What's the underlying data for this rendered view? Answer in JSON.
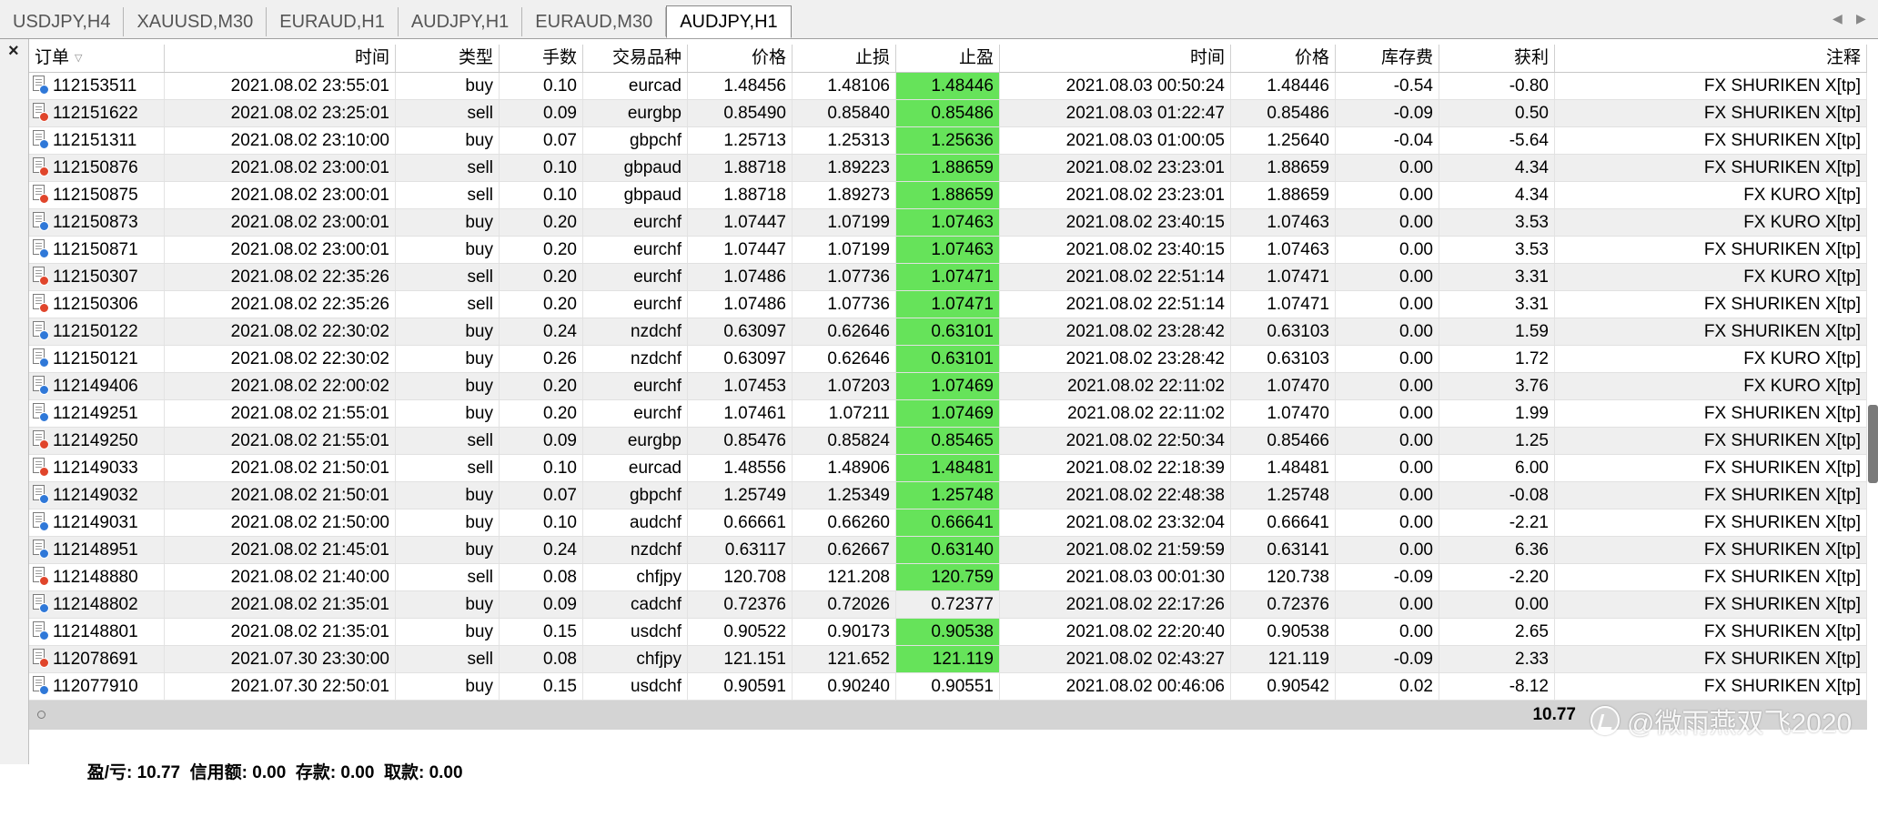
{
  "tabs": [
    "USDJPY,H4",
    "XAUUSD,M30",
    "EURAUD,H1",
    "AUDJPY,H1",
    "EURAUD,M30",
    "AUDJPY,H1"
  ],
  "active_tab_index": 5,
  "columns": [
    "订单",
    "时间",
    "类型",
    "手数",
    "交易品种",
    "价格",
    "止损",
    "止盈",
    "时间",
    "价格",
    "库存费",
    "获利",
    "注释"
  ],
  "tp_highlight_color": "#66e35a",
  "rows": [
    {
      "order": "112153511",
      "open_time": "2021.08.02 23:55:01",
      "type": "buy",
      "lots": "0.10",
      "symbol": "eurcad",
      "price": "1.48456",
      "sl": "1.48106",
      "tp": "1.48446",
      "tp_hit": true,
      "close_time": "2021.08.03 00:50:24",
      "close_price": "1.48446",
      "swap": "-0.54",
      "profit": "-0.80",
      "comment": "FX SHURIKEN X[tp]"
    },
    {
      "order": "112151622",
      "open_time": "2021.08.02 23:25:01",
      "type": "sell",
      "lots": "0.09",
      "symbol": "eurgbp",
      "price": "0.85490",
      "sl": "0.85840",
      "tp": "0.85486",
      "tp_hit": true,
      "close_time": "2021.08.03 01:22:47",
      "close_price": "0.85486",
      "swap": "-0.09",
      "profit": "0.50",
      "comment": "FX SHURIKEN X[tp]"
    },
    {
      "order": "112151311",
      "open_time": "2021.08.02 23:10:00",
      "type": "buy",
      "lots": "0.07",
      "symbol": "gbpchf",
      "price": "1.25713",
      "sl": "1.25313",
      "tp": "1.25636",
      "tp_hit": true,
      "close_time": "2021.08.03 01:00:05",
      "close_price": "1.25640",
      "swap": "-0.04",
      "profit": "-5.64",
      "comment": "FX SHURIKEN X[tp]"
    },
    {
      "order": "112150876",
      "open_time": "2021.08.02 23:00:01",
      "type": "sell",
      "lots": "0.10",
      "symbol": "gbpaud",
      "price": "1.88718",
      "sl": "1.89223",
      "tp": "1.88659",
      "tp_hit": true,
      "close_time": "2021.08.02 23:23:01",
      "close_price": "1.88659",
      "swap": "0.00",
      "profit": "4.34",
      "comment": "FX SHURIKEN X[tp]"
    },
    {
      "order": "112150875",
      "open_time": "2021.08.02 23:00:01",
      "type": "sell",
      "lots": "0.10",
      "symbol": "gbpaud",
      "price": "1.88718",
      "sl": "1.89273",
      "tp": "1.88659",
      "tp_hit": true,
      "close_time": "2021.08.02 23:23:01",
      "close_price": "1.88659",
      "swap": "0.00",
      "profit": "4.34",
      "comment": "FX KURO X[tp]"
    },
    {
      "order": "112150873",
      "open_time": "2021.08.02 23:00:01",
      "type": "buy",
      "lots": "0.20",
      "symbol": "eurchf",
      "price": "1.07447",
      "sl": "1.07199",
      "tp": "1.07463",
      "tp_hit": true,
      "close_time": "2021.08.02 23:40:15",
      "close_price": "1.07463",
      "swap": "0.00",
      "profit": "3.53",
      "comment": "FX KURO X[tp]"
    },
    {
      "order": "112150871",
      "open_time": "2021.08.02 23:00:01",
      "type": "buy",
      "lots": "0.20",
      "symbol": "eurchf",
      "price": "1.07447",
      "sl": "1.07199",
      "tp": "1.07463",
      "tp_hit": true,
      "close_time": "2021.08.02 23:40:15",
      "close_price": "1.07463",
      "swap": "0.00",
      "profit": "3.53",
      "comment": "FX SHURIKEN X[tp]"
    },
    {
      "order": "112150307",
      "open_time": "2021.08.02 22:35:26",
      "type": "sell",
      "lots": "0.20",
      "symbol": "eurchf",
      "price": "1.07486",
      "sl": "1.07736",
      "tp": "1.07471",
      "tp_hit": true,
      "close_time": "2021.08.02 22:51:14",
      "close_price": "1.07471",
      "swap": "0.00",
      "profit": "3.31",
      "comment": "FX KURO X[tp]"
    },
    {
      "order": "112150306",
      "open_time": "2021.08.02 22:35:26",
      "type": "sell",
      "lots": "0.20",
      "symbol": "eurchf",
      "price": "1.07486",
      "sl": "1.07736",
      "tp": "1.07471",
      "tp_hit": true,
      "close_time": "2021.08.02 22:51:14",
      "close_price": "1.07471",
      "swap": "0.00",
      "profit": "3.31",
      "comment": "FX SHURIKEN X[tp]"
    },
    {
      "order": "112150122",
      "open_time": "2021.08.02 22:30:02",
      "type": "buy",
      "lots": "0.24",
      "symbol": "nzdchf",
      "price": "0.63097",
      "sl": "0.62646",
      "tp": "0.63101",
      "tp_hit": true,
      "close_time": "2021.08.02 23:28:42",
      "close_price": "0.63103",
      "swap": "0.00",
      "profit": "1.59",
      "comment": "FX SHURIKEN X[tp]"
    },
    {
      "order": "112150121",
      "open_time": "2021.08.02 22:30:02",
      "type": "buy",
      "lots": "0.26",
      "symbol": "nzdchf",
      "price": "0.63097",
      "sl": "0.62646",
      "tp": "0.63101",
      "tp_hit": true,
      "close_time": "2021.08.02 23:28:42",
      "close_price": "0.63103",
      "swap": "0.00",
      "profit": "1.72",
      "comment": "FX KURO X[tp]"
    },
    {
      "order": "112149406",
      "open_time": "2021.08.02 22:00:02",
      "type": "buy",
      "lots": "0.20",
      "symbol": "eurchf",
      "price": "1.07453",
      "sl": "1.07203",
      "tp": "1.07469",
      "tp_hit": true,
      "close_time": "2021.08.02 22:11:02",
      "close_price": "1.07470",
      "swap": "0.00",
      "profit": "3.76",
      "comment": "FX KURO X[tp]"
    },
    {
      "order": "112149251",
      "open_time": "2021.08.02 21:55:01",
      "type": "buy",
      "lots": "0.20",
      "symbol": "eurchf",
      "price": "1.07461",
      "sl": "1.07211",
      "tp": "1.07469",
      "tp_hit": true,
      "close_time": "2021.08.02 22:11:02",
      "close_price": "1.07470",
      "swap": "0.00",
      "profit": "1.99",
      "comment": "FX SHURIKEN X[tp]"
    },
    {
      "order": "112149250",
      "open_time": "2021.08.02 21:55:01",
      "type": "sell",
      "lots": "0.09",
      "symbol": "eurgbp",
      "price": "0.85476",
      "sl": "0.85824",
      "tp": "0.85465",
      "tp_hit": true,
      "close_time": "2021.08.02 22:50:34",
      "close_price": "0.85466",
      "swap": "0.00",
      "profit": "1.25",
      "comment": "FX SHURIKEN X[tp]"
    },
    {
      "order": "112149033",
      "open_time": "2021.08.02 21:50:01",
      "type": "sell",
      "lots": "0.10",
      "symbol": "eurcad",
      "price": "1.48556",
      "sl": "1.48906",
      "tp": "1.48481",
      "tp_hit": true,
      "close_time": "2021.08.02 22:18:39",
      "close_price": "1.48481",
      "swap": "0.00",
      "profit": "6.00",
      "comment": "FX SHURIKEN X[tp]"
    },
    {
      "order": "112149032",
      "open_time": "2021.08.02 21:50:01",
      "type": "buy",
      "lots": "0.07",
      "symbol": "gbpchf",
      "price": "1.25749",
      "sl": "1.25349",
      "tp": "1.25748",
      "tp_hit": true,
      "close_time": "2021.08.02 22:48:38",
      "close_price": "1.25748",
      "swap": "0.00",
      "profit": "-0.08",
      "comment": "FX SHURIKEN X[tp]"
    },
    {
      "order": "112149031",
      "open_time": "2021.08.02 21:50:00",
      "type": "buy",
      "lots": "0.10",
      "symbol": "audchf",
      "price": "0.66661",
      "sl": "0.66260",
      "tp": "0.66641",
      "tp_hit": true,
      "close_time": "2021.08.02 23:32:04",
      "close_price": "0.66641",
      "swap": "0.00",
      "profit": "-2.21",
      "comment": "FX SHURIKEN X[tp]"
    },
    {
      "order": "112148951",
      "open_time": "2021.08.02 21:45:01",
      "type": "buy",
      "lots": "0.24",
      "symbol": "nzdchf",
      "price": "0.63117",
      "sl": "0.62667",
      "tp": "0.63140",
      "tp_hit": true,
      "close_time": "2021.08.02 21:59:59",
      "close_price": "0.63141",
      "swap": "0.00",
      "profit": "6.36",
      "comment": "FX SHURIKEN X[tp]"
    },
    {
      "order": "112148880",
      "open_time": "2021.08.02 21:40:00",
      "type": "sell",
      "lots": "0.08",
      "symbol": "chfjpy",
      "price": "120.708",
      "sl": "121.208",
      "tp": "120.759",
      "tp_hit": true,
      "close_time": "2021.08.03 00:01:30",
      "close_price": "120.738",
      "swap": "-0.09",
      "profit": "-2.20",
      "comment": "FX SHURIKEN X[tp]"
    },
    {
      "order": "112148802",
      "open_time": "2021.08.02 21:35:01",
      "type": "buy",
      "lots": "0.09",
      "symbol": "cadchf",
      "price": "0.72376",
      "sl": "0.72026",
      "tp": "0.72377",
      "tp_hit": false,
      "close_time": "2021.08.02 22:17:26",
      "close_price": "0.72376",
      "swap": "0.00",
      "profit": "0.00",
      "comment": "FX SHURIKEN X[tp]"
    },
    {
      "order": "112148801",
      "open_time": "2021.08.02 21:35:01",
      "type": "buy",
      "lots": "0.15",
      "symbol": "usdchf",
      "price": "0.90522",
      "sl": "0.90173",
      "tp": "0.90538",
      "tp_hit": true,
      "close_time": "2021.08.02 22:20:40",
      "close_price": "0.90538",
      "swap": "0.00",
      "profit": "2.65",
      "comment": "FX SHURIKEN X[tp]"
    },
    {
      "order": "112078691",
      "open_time": "2021.07.30 23:30:00",
      "type": "sell",
      "lots": "0.08",
      "symbol": "chfjpy",
      "price": "121.151",
      "sl": "121.652",
      "tp": "121.119",
      "tp_hit": true,
      "close_time": "2021.08.02 02:43:27",
      "close_price": "121.119",
      "swap": "-0.09",
      "profit": "2.33",
      "comment": "FX SHURIKEN X[tp]"
    },
    {
      "order": "112077910",
      "open_time": "2021.07.30 22:50:01",
      "type": "buy",
      "lots": "0.15",
      "symbol": "usdchf",
      "price": "0.90591",
      "sl": "0.90240",
      "tp": "0.90551",
      "tp_hit": false,
      "close_time": "2021.08.02 00:46:06",
      "close_price": "0.90542",
      "swap": "0.02",
      "profit": "-8.12",
      "comment": "FX SHURIKEN X[tp]"
    }
  ],
  "footer": {
    "summary": "盈/亏: 10.77  信用额: 0.00  存款: 0.00  取款: 0.00",
    "profit_total": "10.77"
  },
  "watermark": "@微雨燕双飞2020"
}
